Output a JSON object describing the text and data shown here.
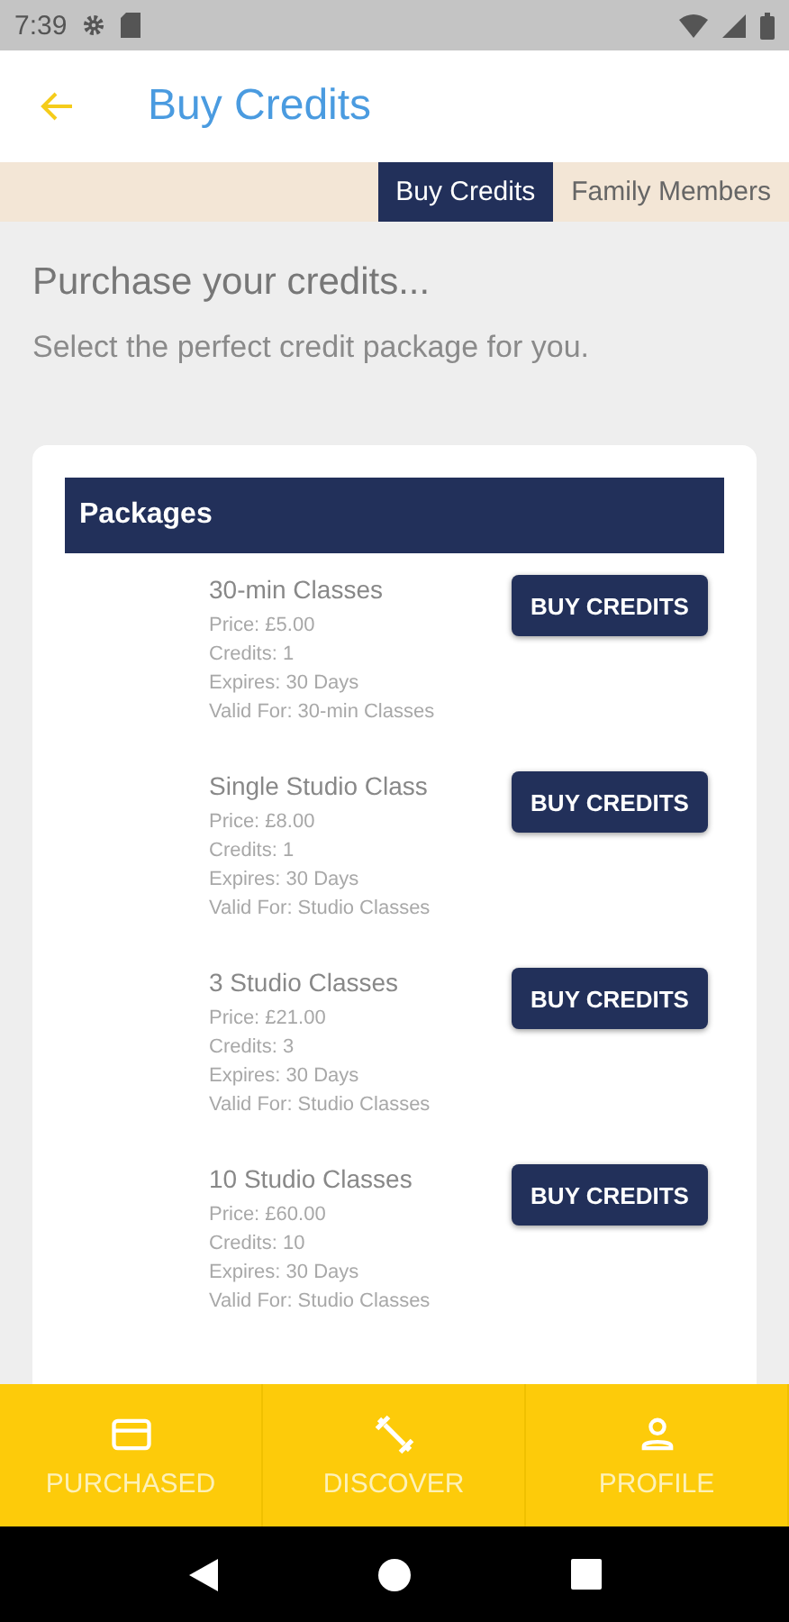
{
  "status_bar": {
    "time": "7:39"
  },
  "app_bar": {
    "title": "Buy Credits"
  },
  "tabs": [
    {
      "label": "Buy Credits",
      "selected": true
    },
    {
      "label": "Family Members",
      "selected": false
    }
  ],
  "intro": {
    "heading": "Purchase your credits...",
    "subheading": "Select the perfect credit package for you."
  },
  "packages": {
    "title": "Packages",
    "items": [
      {
        "name": "30-min Classes",
        "details": [
          "Price: £5.00",
          "Credits: 1",
          "Expires: 30 Days",
          "Valid For: 30-min Classes"
        ],
        "button": "BUY CREDITS"
      },
      {
        "name": "Single Studio Class",
        "details": [
          "Price: £8.00",
          "Credits: 1",
          "Expires: 30 Days",
          "Valid For: Studio Classes"
        ],
        "button": "BUY CREDITS"
      },
      {
        "name": "3 Studio Classes",
        "details": [
          "Price: £21.00",
          "Credits: 3",
          "Expires: 30 Days",
          "Valid For: Studio Classes"
        ],
        "button": "BUY CREDITS"
      },
      {
        "name": "10 Studio Classes",
        "details": [
          "Price: £60.00",
          "Credits: 10",
          "Expires: 30 Days",
          "Valid For: Studio Classes"
        ],
        "button": "BUY CREDITS"
      }
    ]
  },
  "bottom_nav": [
    {
      "label": "PURCHASED",
      "kind": "card"
    },
    {
      "label": "DISCOVER",
      "kind": "dumbbell"
    },
    {
      "label": "PROFILE",
      "kind": "person"
    }
  ]
}
